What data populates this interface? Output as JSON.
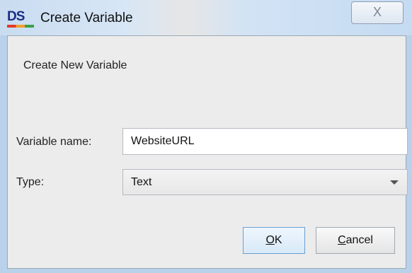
{
  "window": {
    "logo": "DS",
    "title": "Create Variable",
    "close_glyph": "X"
  },
  "dialog": {
    "heading": "Create New Variable",
    "variable_name_label": "Variable name:",
    "variable_name_value": "WebsiteURL",
    "type_label": "Type:",
    "type_selected": "Text",
    "ok_mnemonic": "O",
    "ok_rest": "K",
    "cancel_mnemonic": "C",
    "cancel_rest": "ancel"
  },
  "icons": {
    "close": "close-icon",
    "dropdown": "chevron-down-icon"
  }
}
